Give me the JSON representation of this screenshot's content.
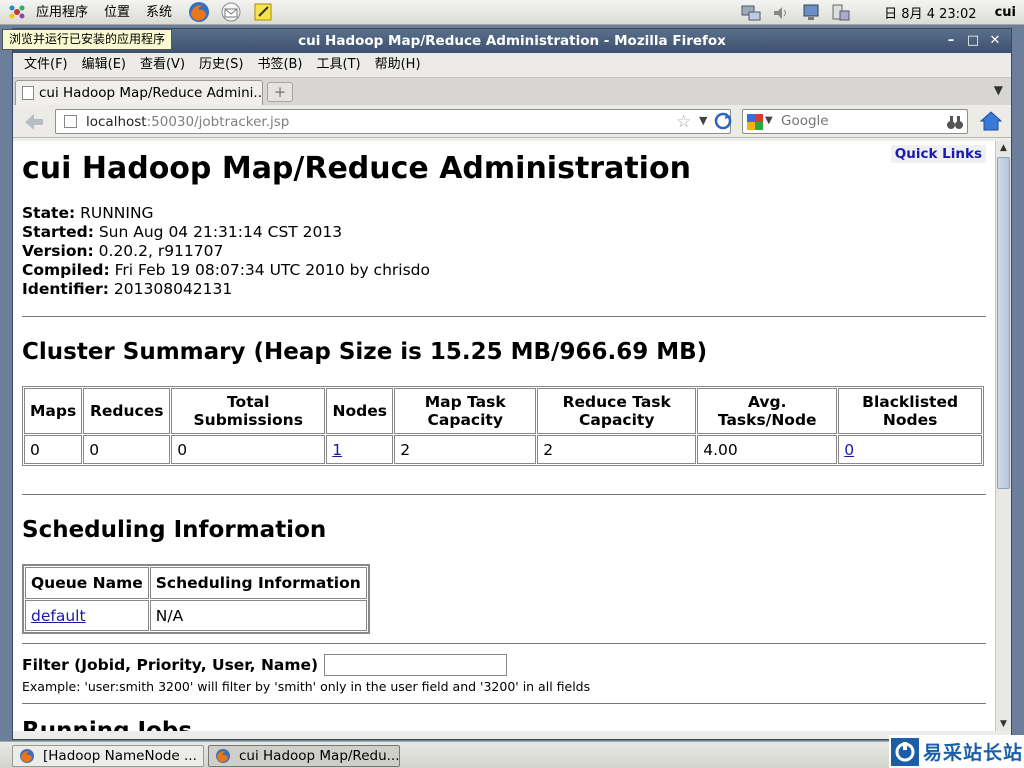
{
  "top_panel": {
    "menus": [
      "应用程序",
      "位置",
      "系统"
    ],
    "clock": "日 8月  4 23:02",
    "user": "cui"
  },
  "tooltip": "浏览并运行已安装的应用程序",
  "window": {
    "title": "cui Hadoop Map/Reduce Administration - Mozilla Firefox"
  },
  "menubar": [
    "文件(F)",
    "编辑(E)",
    "查看(V)",
    "历史(S)",
    "书签(B)",
    "工具(T)",
    "帮助(H)"
  ],
  "tab": {
    "label": "cui Hadoop Map/Reduce Admini..."
  },
  "navbar": {
    "url_host": "localhost",
    "url_rest": ":50030/jobtracker.jsp",
    "search_placeholder": "Google"
  },
  "page": {
    "quick_links": "Quick Links",
    "title": "cui Hadoop Map/Reduce Administration",
    "info": [
      {
        "label": "State:",
        "value": " RUNNING"
      },
      {
        "label": "Started:",
        "value": " Sun Aug 04 21:31:14 CST 2013"
      },
      {
        "label": "Version:",
        "value": " 0.20.2, r911707"
      },
      {
        "label": "Compiled:",
        "value": " Fri Feb 19 08:07:34 UTC 2010 by chrisdo"
      },
      {
        "label": "Identifier:",
        "value": " 201308042131"
      }
    ],
    "cluster_heading": "Cluster Summary (Heap Size is 15.25 MB/966.69 MB)",
    "cluster_headers": [
      "Maps",
      "Reduces",
      "Total Submissions",
      "Nodes",
      "Map Task Capacity",
      "Reduce Task Capacity",
      "Avg. Tasks/Node",
      "Blacklisted Nodes"
    ],
    "cluster_values": [
      "0",
      "0",
      "0",
      "1",
      "2",
      "2",
      "4.00",
      "0"
    ],
    "sched_heading": "Scheduling Information",
    "sched_headers": [
      "Queue Name",
      "Scheduling Information"
    ],
    "sched_row": [
      "default",
      "N/A"
    ],
    "filter_label": "Filter (Jobid, Priority, User, Name)",
    "filter_example": "Example: 'user:smith 3200' will filter by 'smith' only in the user field and '3200' in all fields",
    "running_heading": "Running Jobs"
  },
  "taskbar": {
    "tasks": [
      "[Hadoop NameNode ...",
      "cui Hadoop Map/Redu..."
    ]
  },
  "watermark": "易采站长站"
}
